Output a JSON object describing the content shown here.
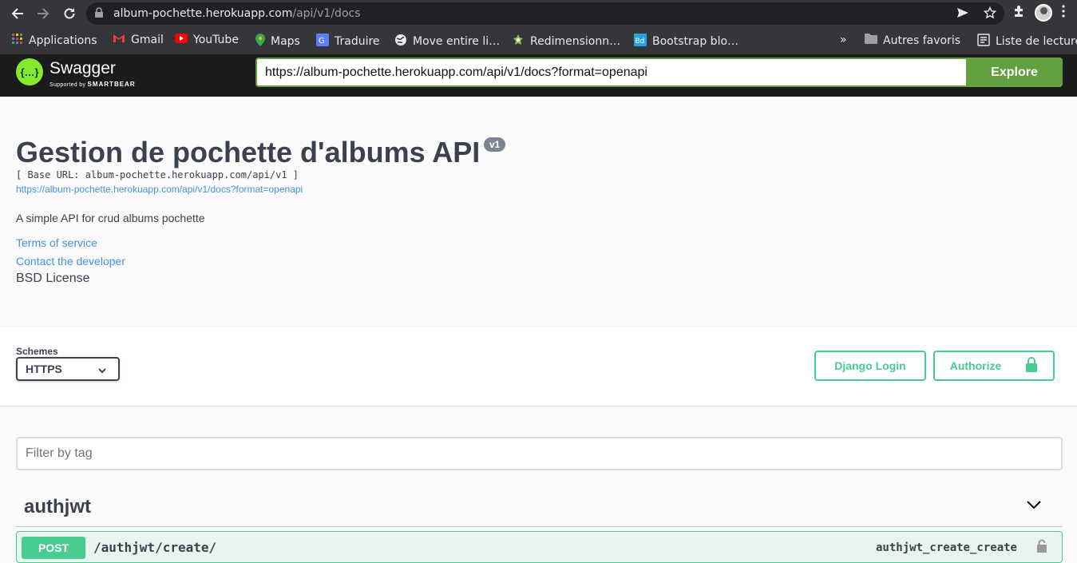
{
  "browser": {
    "url_host": "album-pochette.herokuapp.com",
    "url_path": "/api/v1/docs",
    "bookmarks": [
      {
        "label": "Applications",
        "icon": "apps-grid-icon",
        "color": "#4285f4"
      },
      {
        "label": "Gmail",
        "icon": "gmail-icon",
        "color": "#ea4335"
      },
      {
        "label": "YouTube",
        "icon": "youtube-icon",
        "color": "#ff0000"
      },
      {
        "label": "Maps",
        "icon": "maps-icon",
        "color": "#34a853"
      },
      {
        "label": "Traduire",
        "icon": "translate-icon",
        "color": "#4285f4"
      },
      {
        "label": "Move entire li…",
        "icon": "globe-icon",
        "color": "#e8eaed"
      },
      {
        "label": "Redimensionn…",
        "icon": "puzzle-icon",
        "color": "#8bc34a"
      },
      {
        "label": "Bootstrap blo…",
        "icon": "bootstrap-icon",
        "color": "#29a3e0"
      }
    ],
    "overflow": "»",
    "other_bookmarks": "Autres favoris",
    "reading_list": "Liste de lecture"
  },
  "topbar": {
    "brand": "Swagger",
    "brand_sub_prefix": "Supported by",
    "brand_sub_company": "SMARTBEAR",
    "logo_glyph": "{…}",
    "spec_url": "https://album-pochette.herokuapp.com/api/v1/docs?format=openapi",
    "explore_label": "Explore",
    "accent": "#62a03f"
  },
  "info": {
    "title": "Gestion de pochette d'albums API",
    "version": "v1",
    "base_url": "[ Base URL: album-pochette.herokuapp.com/api/v1 ]",
    "spec_link": "https://album-pochette.herokuapp.com/api/v1/docs?format=openapi",
    "description": "A simple API for crud albums pochette",
    "terms": "Terms of service",
    "contact": "Contact the developer",
    "license": "BSD License"
  },
  "schemes": {
    "title": "Schemes",
    "selected": "HTTPS",
    "django_login": "Django Login",
    "authorize": "Authorize",
    "accent": "#49cc90"
  },
  "filter": {
    "placeholder": "Filter by tag"
  },
  "tags": [
    {
      "name": "authjwt",
      "operations": [
        {
          "method": "POST",
          "path": "/authjwt/create/",
          "operation_id": "authjwt_create_create",
          "color": "#49cc90"
        }
      ]
    }
  ]
}
